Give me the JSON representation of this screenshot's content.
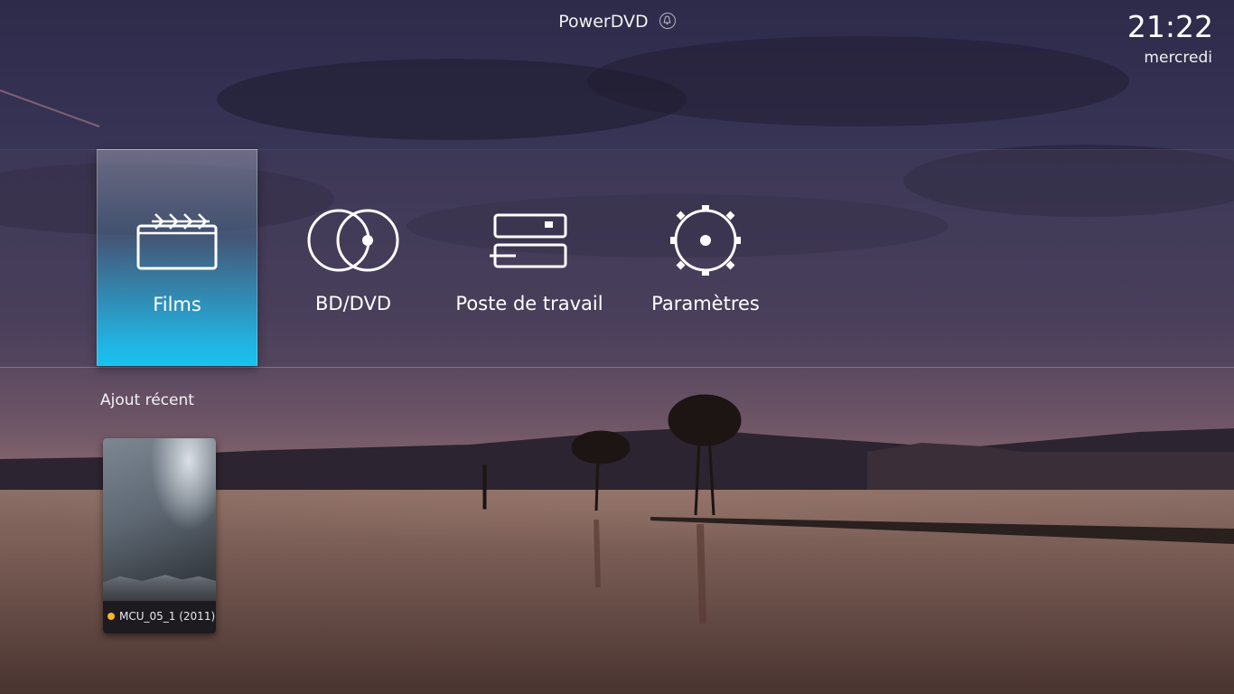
{
  "header": {
    "app_title": "PowerDVD",
    "notification_icon": "bell-icon",
    "time": "21:22",
    "day": "mercredi"
  },
  "main_menu": {
    "items": [
      {
        "label": "Films",
        "icon": "clapperboard-icon",
        "selected": true
      },
      {
        "label": "BD/DVD",
        "icon": "disc-icon",
        "selected": false
      },
      {
        "label": "Poste de travail",
        "icon": "drives-icon",
        "selected": false
      },
      {
        "label": "Paramètres",
        "icon": "gear-icon",
        "selected": false
      }
    ]
  },
  "recent": {
    "section_title": "Ajout récent",
    "items": [
      {
        "title": "MCU_05_1 (2011)",
        "status_color": "#f7b62a"
      }
    ]
  },
  "colors": {
    "accent": "#1fb6e6",
    "status_new": "#f7b62a"
  }
}
